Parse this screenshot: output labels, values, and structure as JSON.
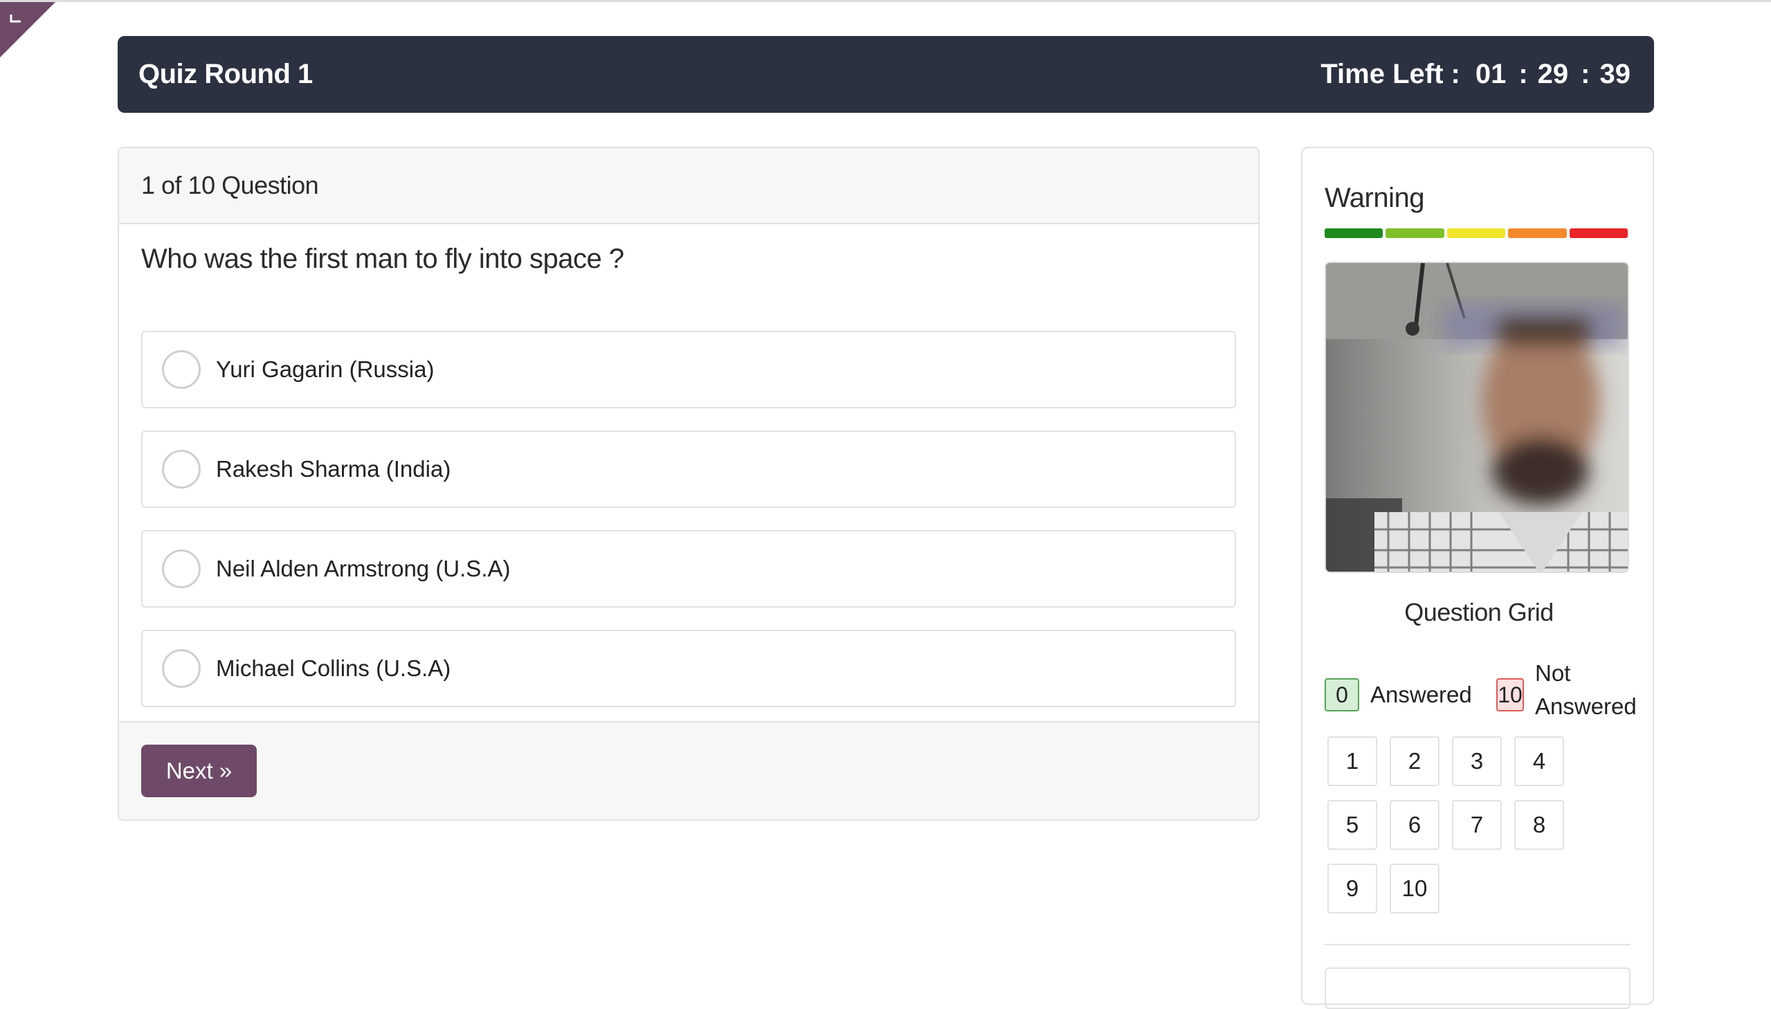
{
  "header": {
    "title": "Quiz Round 1",
    "timer_label": "Time Left :",
    "hours": "01",
    "minutes": "29",
    "seconds": "39"
  },
  "question": {
    "progress": "1 of 10 Question",
    "text": "Who was the first man to fly into space ?",
    "options": [
      {
        "label": "Yuri Gagarin (Russia)",
        "selected": false
      },
      {
        "label": "Rakesh Sharma (India)",
        "selected": false
      },
      {
        "label": "Neil Alden Armstrong (U.S.A)",
        "selected": false
      },
      {
        "label": "Michael Collins (U.S.A)",
        "selected": false
      }
    ],
    "next_label": "Next »"
  },
  "sidebar": {
    "warning_title": "Warning",
    "warning_levels": [
      "#1e8a1e",
      "#7fbf2a",
      "#f2e52a",
      "#f2892a",
      "#e8232a"
    ],
    "question_grid_title": "Question Grid",
    "answered_count": "0",
    "answered_label": "Answered",
    "not_answered_count": "10",
    "not_answered_label_1": "Not",
    "not_answered_label_2": "Answered",
    "grid": [
      "1",
      "2",
      "3",
      "4",
      "5",
      "6",
      "7",
      "8",
      "9",
      "10"
    ]
  },
  "colors": {
    "header_bg": "#2b3140",
    "accent": "#6e4a68"
  }
}
